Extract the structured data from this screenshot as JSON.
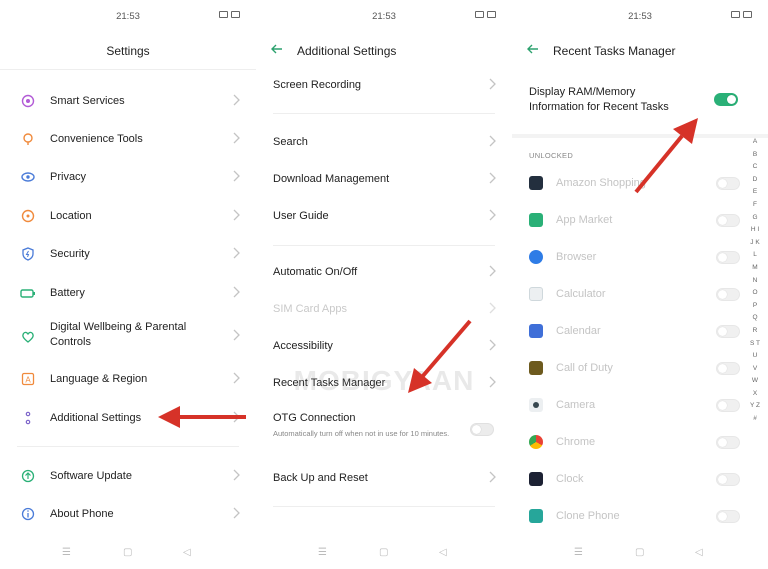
{
  "status": {
    "time": "21:53"
  },
  "screen1": {
    "title": "Settings",
    "items": [
      {
        "label": "Smart Services",
        "icon": "smart-services-icon",
        "color": "#b25bd6"
      },
      {
        "label": "Convenience Tools",
        "icon": "convenience-tools-icon",
        "color": "#f08a3c"
      },
      {
        "label": "Privacy",
        "icon": "privacy-icon",
        "color": "#4a7bd8"
      },
      {
        "label": "Location",
        "icon": "location-icon",
        "color": "#f08a3c"
      },
      {
        "label": "Security",
        "icon": "security-icon",
        "color": "#4a7bd8"
      },
      {
        "label": "Battery",
        "icon": "battery-icon",
        "color": "#2ab077"
      },
      {
        "label": "Digital Wellbeing & Parental Controls",
        "icon": "wellbeing-icon",
        "color": "#2ab077"
      },
      {
        "label": "Language & Region",
        "icon": "language-icon",
        "color": "#f08a3c"
      },
      {
        "label": "Additional Settings",
        "icon": "additional-settings-icon",
        "color": "#7b62c9"
      },
      {
        "label": "Software Update",
        "icon": "software-update-icon",
        "color": "#2ab077"
      },
      {
        "label": "About Phone",
        "icon": "about-phone-icon",
        "color": "#4a7bd8"
      }
    ]
  },
  "screen2": {
    "title": "Additional Settings",
    "items": [
      {
        "label": "Screen Recording"
      },
      {
        "label": "Search"
      },
      {
        "label": "Download Management"
      },
      {
        "label": "User Guide"
      },
      {
        "label": "Automatic On/Off"
      },
      {
        "label": "SIM Card Apps"
      },
      {
        "label": "Accessibility"
      },
      {
        "label": "Recent Tasks Manager"
      },
      {
        "label": "OTG Connection",
        "subtext": "Automatically turn off when not in use for 10 minutes."
      },
      {
        "label": "Back Up and Reset"
      }
    ]
  },
  "screen3": {
    "title": "Recent Tasks Manager",
    "display_ram_label": "Display RAM/Memory Information for Recent Tasks",
    "section": "UNLOCKED",
    "apps": [
      {
        "name": "Amazon Shopping",
        "color": "#232f3e"
      },
      {
        "name": "App Market",
        "color": "#2ab077"
      },
      {
        "name": "Browser",
        "color": "#2e7ce6"
      },
      {
        "name": "Calculator",
        "color": "#cfd8dc"
      },
      {
        "name": "Calendar",
        "color": "#3f6fd8"
      },
      {
        "name": "Call of Duty",
        "color": "#6d5a1e"
      },
      {
        "name": "Camera",
        "color": "#37474f"
      },
      {
        "name": "Chrome",
        "color": "#e94235"
      },
      {
        "name": "Clock",
        "color": "#1c2133"
      },
      {
        "name": "Clone Phone",
        "color": "#26a69a"
      }
    ],
    "alphabet": "A B C D E F G H I J K L M N O P Q R S T U V W X Y Z #"
  },
  "watermark": "MOBIGYAAN",
  "colors": {
    "accent": "#2ab077",
    "arrow": "#d63228"
  }
}
